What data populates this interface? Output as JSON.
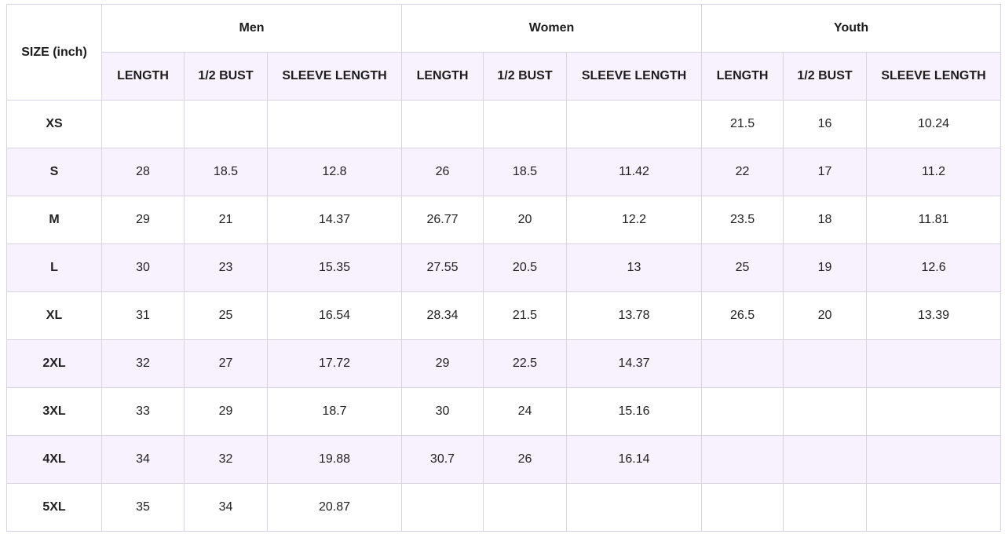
{
  "table": {
    "size_header": "SIZE (inch)",
    "groups": [
      "Men",
      "Women",
      "Youth"
    ],
    "subheaders": [
      "LENGTH",
      "1/2 BUST",
      "SLEEVE LENGTH",
      "LENGTH",
      "1/2 BUST",
      "SLEEVE LENGTH",
      "LENGTH",
      "1/2 BUST",
      "SLEEVE LENGTH"
    ],
    "rows": [
      {
        "size": "XS",
        "cells": [
          "",
          "",
          "",
          "",
          "",
          "",
          "21.5",
          "16",
          "10.24"
        ]
      },
      {
        "size": "S",
        "cells": [
          "28",
          "18.5",
          "12.8",
          "26",
          "18.5",
          "11.42",
          "22",
          "17",
          "11.2"
        ]
      },
      {
        "size": "M",
        "cells": [
          "29",
          "21",
          "14.37",
          "26.77",
          "20",
          "12.2",
          "23.5",
          "18",
          "11.81"
        ]
      },
      {
        "size": "L",
        "cells": [
          "30",
          "23",
          "15.35",
          "27.55",
          "20.5",
          "13",
          "25",
          "19",
          "12.6"
        ]
      },
      {
        "size": "XL",
        "cells": [
          "31",
          "25",
          "16.54",
          "28.34",
          "21.5",
          "13.78",
          "26.5",
          "20",
          "13.39"
        ]
      },
      {
        "size": "2XL",
        "cells": [
          "32",
          "27",
          "17.72",
          "29",
          "22.5",
          "14.37",
          "",
          "",
          ""
        ]
      },
      {
        "size": "3XL",
        "cells": [
          "33",
          "29",
          "18.7",
          "30",
          "24",
          "15.16",
          "",
          "",
          ""
        ]
      },
      {
        "size": "4XL",
        "cells": [
          "34",
          "32",
          "19.88",
          "30.7",
          "26",
          "16.14",
          "",
          "",
          ""
        ]
      },
      {
        "size": "5XL",
        "cells": [
          "35",
          "34",
          "20.87",
          "",
          "",
          "",
          "",
          "",
          ""
        ]
      }
    ]
  },
  "colors": {
    "border": "#d9d4e3",
    "stripe": "#f7f2fd",
    "text": "#222222"
  }
}
